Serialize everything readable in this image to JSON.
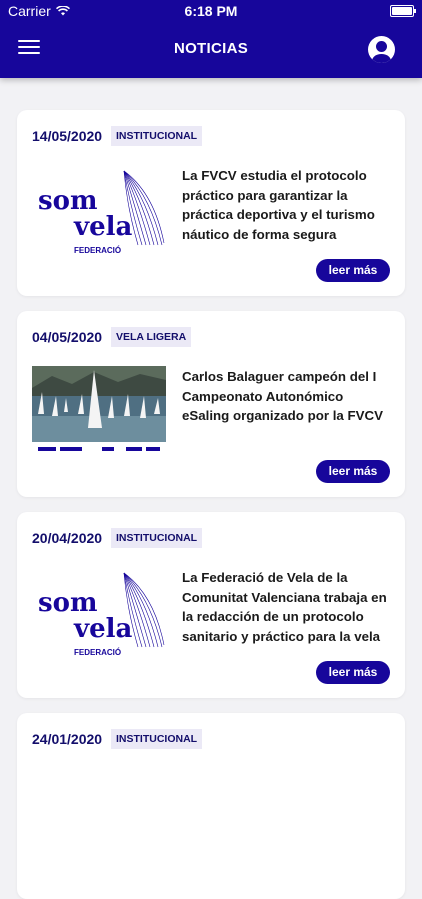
{
  "status": {
    "carrier": "Carrier",
    "time": "6:18 PM"
  },
  "header": {
    "title": "NOTICIAS"
  },
  "buttons": {
    "read_more": "leer más"
  },
  "news": [
    {
      "date": "14/05/2020",
      "category": "INSTITUCIONAL",
      "image": "somvela-logo",
      "title": "La FVCV estudia el protocolo práctico para garantizar la práctica deportiva y el turismo náutico de forma segura"
    },
    {
      "date": "04/05/2020",
      "category": "VELA LIGERA",
      "image": "sailing-photo",
      "title": "Carlos Balaguer campeón del I Campeonato Autonómico eSaling organizado por la FVCV"
    },
    {
      "date": "20/04/2020",
      "category": "INSTITUCIONAL",
      "image": "somvela-logo",
      "title": "La Federació de Vela de la Comunitat Valenciana trabaja en la redacción de un protocolo sanitario y práctico para la vela"
    },
    {
      "date": "24/01/2020",
      "category": "INSTITUCIONAL",
      "image": "",
      "title": ""
    }
  ],
  "logo": {
    "line1": "som",
    "line2": "vela",
    "caption": "FEDERACIÓ"
  },
  "colors": {
    "primary": "#17069b",
    "background": "#f2f2f5",
    "tag_bg": "#ebe9f6"
  }
}
